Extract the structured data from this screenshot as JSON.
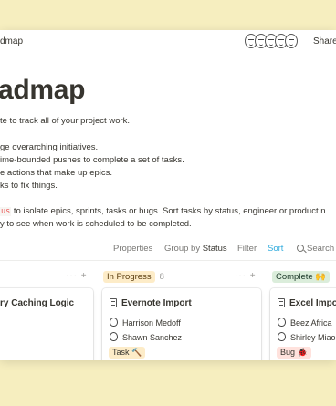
{
  "header": {
    "breadcrumb": "dmap",
    "share_label": "Share"
  },
  "page": {
    "title": "admap",
    "lines": [
      "te to track all of your project work.",
      "ge overarching initiatives.",
      "ime-bounded pushes to complete a set of tasks.",
      "e actions that make up epics.",
      "ks to fix things."
    ],
    "code_snippet": "us",
    "line_after_code": " to isolate epics, sprints, tasks or bugs. Sort tasks by status, engineer or product n",
    "last_line": "y to see when work is scheduled to be completed."
  },
  "toolbar": {
    "properties": "Properties",
    "group_by": "Group by",
    "group_value": "Status",
    "filter": "Filter",
    "sort": "Sort",
    "search": "Search"
  },
  "columns": [
    {
      "label": "",
      "controls": "··· +"
    },
    {
      "label": "In Progress",
      "count": "8",
      "controls": "··· +",
      "color": "#fdecc8"
    },
    {
      "label": "Complete 🙌",
      "color": "#dbeddb"
    }
  ],
  "cards": [
    {
      "title": "ry Caching Logic"
    },
    {
      "title": "Evernote Import",
      "people": [
        "Harrison Medoff",
        "Shawn Sanchez"
      ],
      "tag": "Task 🔨",
      "tag_color": "#fdecc8"
    },
    {
      "title": "Excel Impor",
      "people": [
        "Beez Africa",
        "Shirley Miao"
      ],
      "tag": "Bug 🐞",
      "tag_color": "#ffe2dd"
    }
  ]
}
